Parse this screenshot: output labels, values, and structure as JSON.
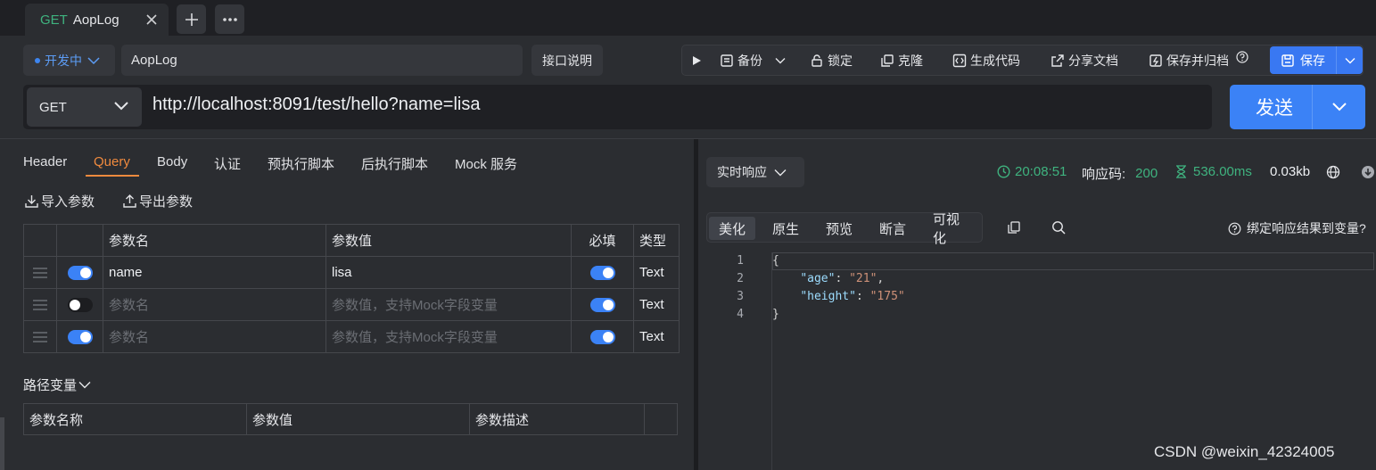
{
  "tab": {
    "method": "GET",
    "name": "AopLog"
  },
  "top": {
    "status": "开发中",
    "api_name": "AopLog",
    "doc_button": "接口说明",
    "toolbar": {
      "backup": "备份",
      "lock": "锁定",
      "clone": "克隆",
      "gen_code": "生成代码",
      "share": "分享文档",
      "save_archive": "保存并归档",
      "save": "保存"
    }
  },
  "request": {
    "method": "GET",
    "url": "http://localhost:8091/test/hello?name=lisa",
    "send": "发送"
  },
  "req_tabs": [
    "Header",
    "Query",
    "Body",
    "认证",
    "预执行脚本",
    "后执行脚本",
    "Mock 服务"
  ],
  "actions": {
    "import": "导入参数",
    "export": "导出参数"
  },
  "params": {
    "headers": {
      "name": "参数名",
      "value": "参数值",
      "required": "必填",
      "type": "类型"
    },
    "rows": [
      {
        "name": "name",
        "value": "lisa",
        "type": "Text",
        "enabled": true,
        "required": true
      },
      {
        "name_placeholder": "参数名",
        "value_placeholder": "参数值，支持Mock字段变量",
        "type": "Text",
        "enabled": false,
        "required": true
      },
      {
        "name_placeholder": "参数名",
        "value_placeholder": "参数值，支持Mock字段变量",
        "type": "Text",
        "enabled": true,
        "required": true
      }
    ]
  },
  "path_vars": {
    "title": "路径变量",
    "headers": {
      "name": "参数名称",
      "value": "参数值",
      "desc": "参数描述"
    }
  },
  "response": {
    "mode": "实时响应",
    "time": "20:08:51",
    "code_label": "响应码:",
    "code": "200",
    "duration": "536.00ms",
    "size": "0.03kb",
    "views": [
      "美化",
      "原生",
      "预览",
      "断言",
      "可视化"
    ],
    "bind_label": "绑定响应结果到变量?",
    "body": {
      "line_numbers": [
        "1",
        "2",
        "3",
        "4"
      ],
      "open_brace": "{",
      "close_brace": "}",
      "fields": [
        {
          "key": "\"age\"",
          "value": "\"21\"",
          "trail": ","
        },
        {
          "key": "\"height\"",
          "value": "\"175\"",
          "trail": ""
        }
      ]
    }
  },
  "watermark": "CSDN @weixin_42324005"
}
